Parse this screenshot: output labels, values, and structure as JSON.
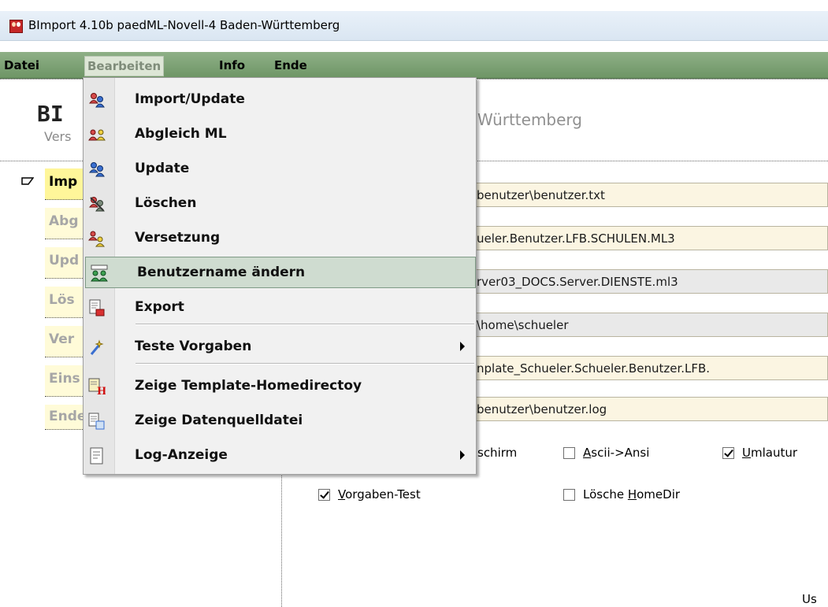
{
  "window": {
    "title": "BImport 4.10b   paedML-Novell-4 Baden-Württemberg",
    "icon": "app-icon"
  },
  "menubar": [
    {
      "label": "Datei",
      "active": false
    },
    {
      "label": "Bearbeiten",
      "active": true
    },
    {
      "label": "Info",
      "active": false
    },
    {
      "label": "Ende",
      "active": false
    }
  ],
  "header": {
    "title": "BI",
    "version": "Vers",
    "land": "Württemberg"
  },
  "nav": [
    {
      "label": "Imp",
      "active": true
    },
    {
      "label": "Abg",
      "active": false
    },
    {
      "label": "Upd",
      "active": false
    },
    {
      "label": "Lös",
      "active": false
    },
    {
      "label": "Ver",
      "active": false
    },
    {
      "label": "Eins",
      "active": false
    },
    {
      "label": "Ende",
      "active": false
    }
  ],
  "fields": [
    {
      "value": "benutzer\\benutzer.txt",
      "style": "beige"
    },
    {
      "value": "ueler.Benutzer.LFB.SCHULEN.ML3",
      "style": "beige"
    },
    {
      "value": "rver03_DOCS.Server.DIENSTE.ml3",
      "style": "gray"
    },
    {
      "value": "\\home\\schueler",
      "style": "gray"
    },
    {
      "value": "nplate_Schueler.Schueler.Benutzer.LFB.",
      "style": "beige"
    },
    {
      "value": "benutzer\\benutzer.log",
      "style": "beige"
    }
  ],
  "checkboxes": {
    "bildschirm": {
      "label": "schirm",
      "checked": false
    },
    "ascii_ansi": {
      "label_prefix": "",
      "mnemonic": "A",
      "label_rest": "scii->Ansi",
      "checked": false
    },
    "umlaute": {
      "label_prefix": "",
      "mnemonic": "U",
      "label_rest": "mlautur",
      "checked": true
    },
    "vorgaben_test": {
      "label_prefix": "",
      "mnemonic": "V",
      "label_rest": "orgaben-Test",
      "checked": true
    },
    "loesche_homedir": {
      "label_prefix": "Lösche ",
      "mnemonic": "H",
      "label_rest": "omeDir",
      "checked": false
    }
  },
  "status_text": "Us",
  "dropdown": {
    "items": [
      {
        "label": "Import/Update",
        "icon": "users-import-icon",
        "submenu": false,
        "highlighted": false
      },
      {
        "label": "Abgleich ML",
        "icon": "users-compare-icon",
        "submenu": false,
        "highlighted": false
      },
      {
        "label": "Update",
        "icon": "users-update-icon",
        "submenu": false,
        "highlighted": false
      },
      {
        "label": "Löschen",
        "icon": "users-delete-icon",
        "submenu": false,
        "highlighted": false
      },
      {
        "label": "Versetzung",
        "icon": "users-transfer-icon",
        "submenu": false,
        "highlighted": false
      },
      {
        "label": "Benutzername ändern",
        "icon": "users-rename-icon",
        "submenu": false,
        "highlighted": true
      },
      {
        "label": "Export",
        "icon": "export-icon",
        "submenu": false,
        "highlighted": false
      },
      {
        "label": "Teste Vorgaben",
        "icon": "test-wand-icon",
        "submenu": true,
        "highlighted": false
      },
      {
        "label": "Zeige Template-Homedirectoy",
        "icon": "template-homedir-icon",
        "submenu": false,
        "highlighted": false
      },
      {
        "label": "Zeige Datenquelldatei",
        "icon": "datasource-file-icon",
        "submenu": false,
        "highlighted": false
      },
      {
        "label": "Log-Anzeige",
        "icon": "log-document-icon",
        "submenu": true,
        "highlighted": false
      }
    ]
  },
  "colors": {
    "menubar": "#7fa276",
    "nav_active": "#fff69a",
    "nav_inactive": "#fffbd8",
    "menu_highlight": "#cfdcd0"
  }
}
